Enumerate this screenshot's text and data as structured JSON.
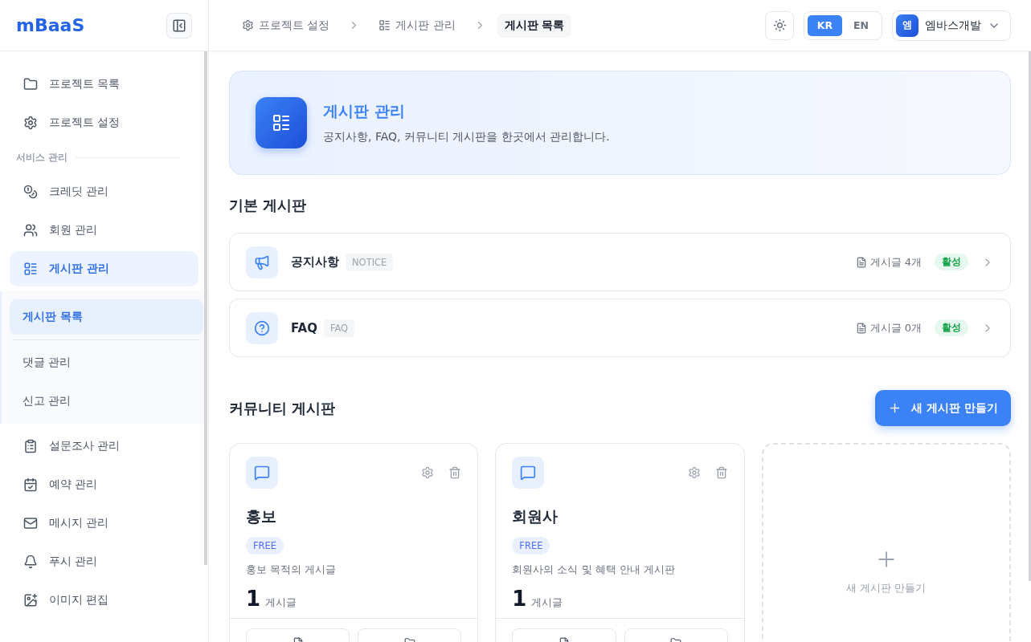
{
  "sidebar": {
    "logo": "mBaaS",
    "items": [
      {
        "kind": "item",
        "label": "프로젝트 목록",
        "selected": false
      },
      {
        "kind": "item",
        "label": "프로젝트 설정",
        "selected": false
      },
      {
        "kind": "section",
        "label": "서비스 관리"
      },
      {
        "kind": "item",
        "label": "크레딧 관리",
        "selected": false
      },
      {
        "kind": "item",
        "label": "회원 관리",
        "selected": false
      },
      {
        "kind": "item",
        "label": "게시판 관리",
        "selected": true,
        "expanded": true,
        "children": [
          {
            "label": "게시판 목록",
            "selected": true
          },
          {
            "label": "댓글 관리",
            "selected": false
          },
          {
            "label": "신고 관리",
            "selected": false
          }
        ]
      },
      {
        "kind": "item",
        "label": "설문조사 관리",
        "selected": false
      },
      {
        "kind": "item",
        "label": "예약 관리",
        "selected": false
      },
      {
        "kind": "item",
        "label": "메시지 관리",
        "selected": false
      },
      {
        "kind": "item",
        "label": "푸시 관리",
        "selected": false
      },
      {
        "kind": "item",
        "label": "이미지 편집",
        "selected": false
      }
    ]
  },
  "breadcrumbs": [
    {
      "label": "프로젝트 설정",
      "selected": false
    },
    {
      "label": "게시판 관리",
      "selected": false
    },
    {
      "label": "게시판 목록",
      "selected": true
    }
  ],
  "languages": [
    {
      "label": "KR",
      "selected": true
    },
    {
      "label": "EN",
      "selected": false
    }
  ],
  "user": {
    "avatar": "엠",
    "name": "엠바스개발"
  },
  "banner": {
    "title": "게시판 관리",
    "description": "공지사항, FAQ, 커뮤니티 게시판을 한곳에서 관리합니다."
  },
  "basic_boards": {
    "title": "기본 게시판",
    "boards": [
      {
        "name": "공지사항",
        "code": "NOTICE",
        "count": "게시글 4개",
        "status": "활성"
      },
      {
        "name": "FAQ",
        "code": "FAQ",
        "count": "게시글 0개",
        "status": "활성"
      }
    ]
  },
  "community_boards": {
    "title": "커뮤니티 게시판",
    "create_button": "새 게시판 만들기",
    "boards": [
      {
        "name": "홍보",
        "type": "FREE",
        "description": "홍보 목적의 게시글",
        "count": "1",
        "count_label": "게시글"
      },
      {
        "name": "회원사",
        "type": "FREE",
        "description": "회원사의 소식 및 혜택 안내 게시판",
        "count": "1",
        "count_label": "게시글"
      }
    ],
    "add_card": "새 게시판 만들기"
  }
}
